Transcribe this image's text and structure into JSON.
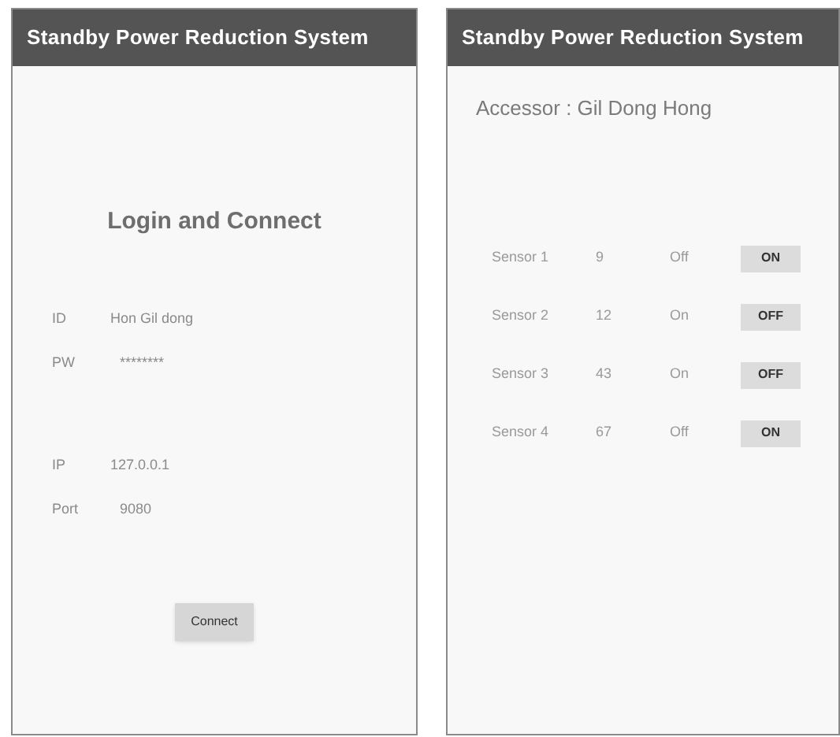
{
  "login_screen": {
    "app_title": "Standby Power Reduction System",
    "heading": "Login and Connect",
    "account_fields": [
      {
        "label": "ID",
        "value": "Hon Gil dong"
      },
      {
        "label": "PW",
        "value": "********"
      }
    ],
    "server_fields": [
      {
        "label": "IP",
        "value": "127.0.0.1"
      },
      {
        "label": "Port",
        "value": "9080"
      }
    ],
    "connect_button": "Connect"
  },
  "sensor_screen": {
    "app_title": "Standby Power Reduction System",
    "accessor": "Accessor : Gil Dong Hong",
    "sensors": [
      {
        "name": "Sensor 1",
        "reading": "9",
        "status": "Off",
        "button": "ON"
      },
      {
        "name": "Sensor 2",
        "reading": "12",
        "status": "On",
        "button": "OFF"
      },
      {
        "name": "Sensor 3",
        "reading": "43",
        "status": "On",
        "button": "OFF"
      },
      {
        "name": "Sensor 4",
        "reading": "67",
        "status": "Off",
        "button": "ON"
      }
    ]
  }
}
